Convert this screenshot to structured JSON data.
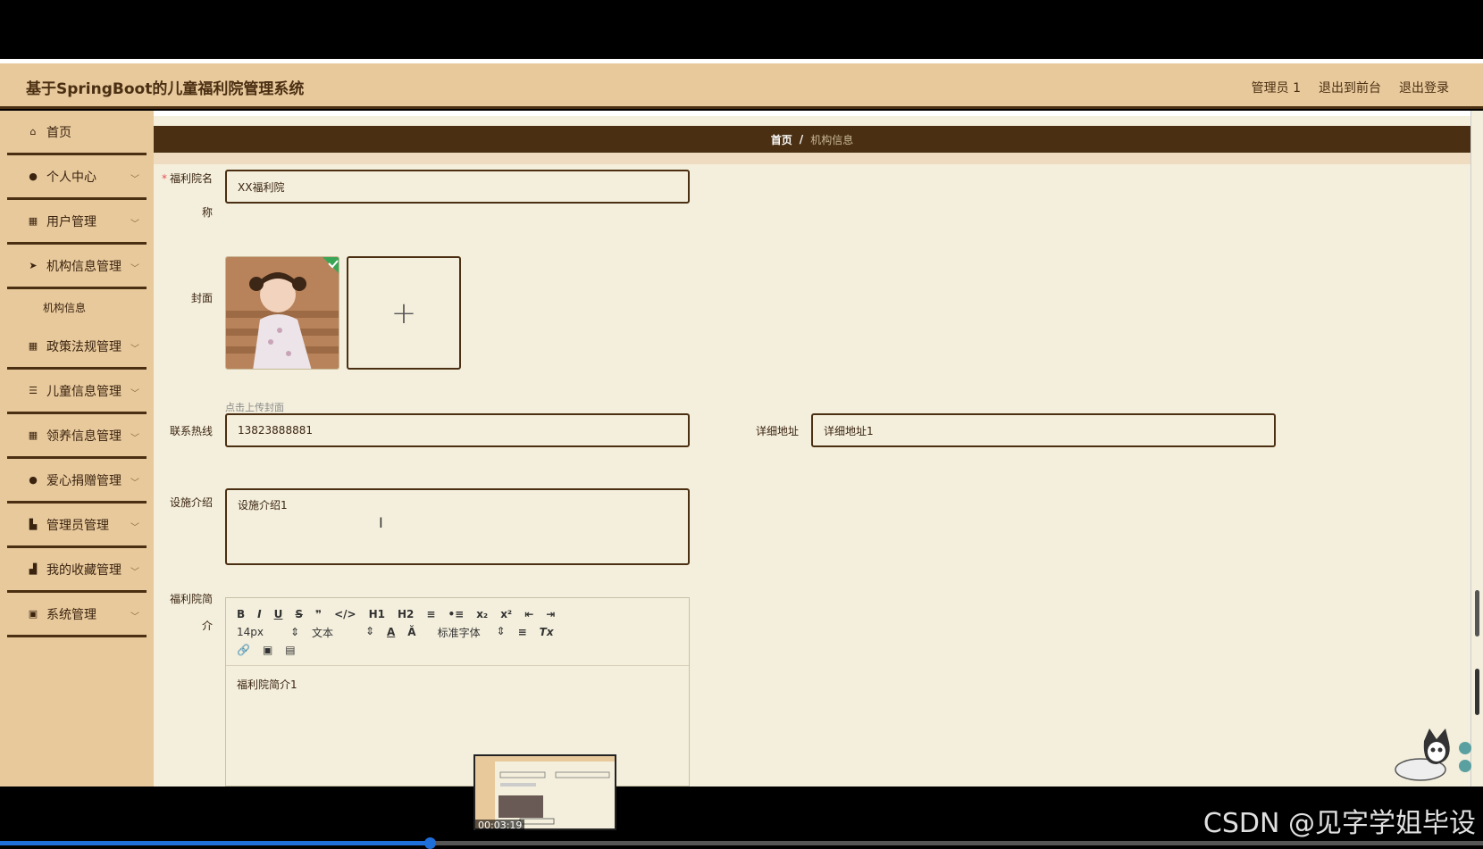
{
  "app": {
    "title": "基于SpringBoot的儿童福利院管理系统",
    "user": "管理员 1",
    "link_front": "退出到前台",
    "link_logout": "退出登录"
  },
  "sidebar": {
    "items": [
      {
        "label": "首页",
        "icon": "home-icon",
        "glyph": "⌂",
        "has_chevron": false
      },
      {
        "label": "个人中心",
        "icon": "user-icon",
        "glyph": "●",
        "has_chevron": true
      },
      {
        "label": "用户管理",
        "icon": "grid-icon",
        "glyph": "▦",
        "has_chevron": true
      },
      {
        "label": "机构信息管理",
        "icon": "send-icon",
        "glyph": "➤",
        "has_chevron": true,
        "sub": "机构信息"
      },
      {
        "label": "政策法规管理",
        "icon": "grid-icon",
        "glyph": "▦",
        "has_chevron": true
      },
      {
        "label": "儿童信息管理",
        "icon": "list-icon",
        "glyph": "☰",
        "has_chevron": true
      },
      {
        "label": "领养信息管理",
        "icon": "grid-icon",
        "glyph": "▦",
        "has_chevron": true
      },
      {
        "label": "爱心捐赠管理",
        "icon": "user-icon",
        "glyph": "●",
        "has_chevron": true
      },
      {
        "label": "管理员管理",
        "icon": "building-icon",
        "glyph": "▙",
        "has_chevron": true
      },
      {
        "label": "我的收藏管理",
        "icon": "bar-chart-icon",
        "glyph": "▟",
        "has_chevron": true
      },
      {
        "label": "系统管理",
        "icon": "clipboard-icon",
        "glyph": "▣",
        "has_chevron": true
      }
    ]
  },
  "breadcrumb": {
    "home": "首页",
    "sep": "/",
    "current": "机构信息"
  },
  "form": {
    "name_label_1": "福利院名",
    "name_label_2": "称",
    "name_value": "XX福利院",
    "cover_label": "封面",
    "cover_hint": "点击上传封面",
    "cover_add": "+",
    "phone_label": "联系热线",
    "phone_value": "13823888881",
    "address_label": "详细地址",
    "address_value": "详细地址1",
    "facility_label": "设施介绍",
    "facility_value": "设施介绍1",
    "intro_label_1": "福利院简",
    "intro_label_2": "介",
    "intro_value": "福利院简介1"
  },
  "editor": {
    "row1": [
      "B",
      "I",
      "U",
      "S",
      "❞",
      "</>",
      "H1",
      "H2",
      "≡",
      "•≡",
      "x₂",
      "x²",
      "⇤",
      "⇥"
    ],
    "font_size": "14px",
    "block_type": "文本",
    "font_family": "标准字体",
    "row2_icons": [
      "A",
      "Ă",
      "≡",
      "Tx"
    ],
    "row3": [
      "🔗",
      "▣",
      "▤"
    ]
  },
  "video": {
    "time": "00:03:19",
    "progress_fraction": 0.29
  },
  "watermark": "CSDN @见字学姐毕设",
  "colors": {
    "header_bg": "#e8c99c",
    "dark_brown": "#4a2f12",
    "main_bg": "#f4efdc"
  }
}
